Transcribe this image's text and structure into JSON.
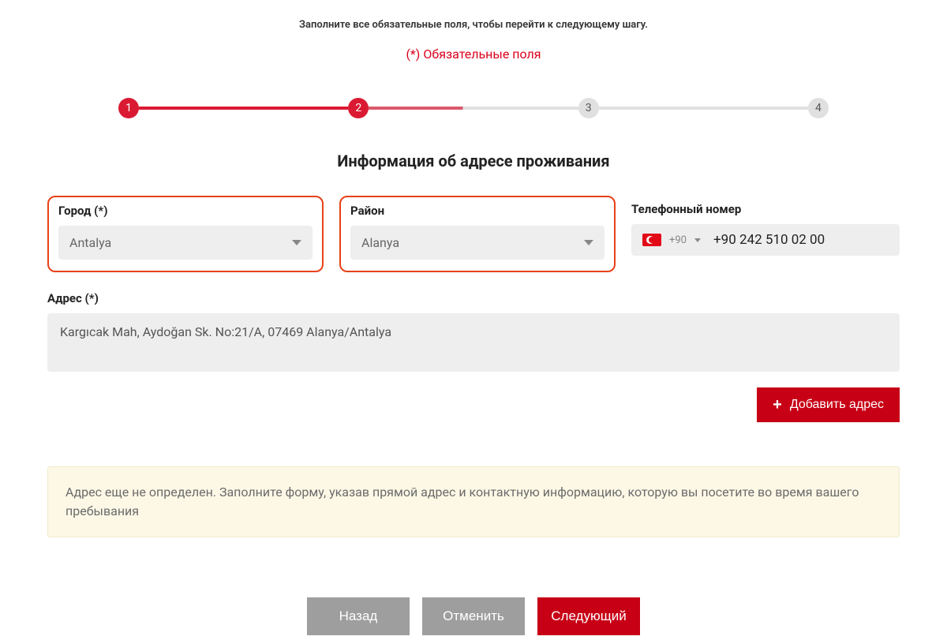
{
  "instruction": "Заполните все обязательные поля, чтобы перейти к следующему шагу.",
  "required_note": "(*) Обязательные поля",
  "stepper": {
    "s1": "1",
    "s2": "2",
    "s3": "3",
    "s4": "4"
  },
  "section_title": "Информация об адресе проживания",
  "city": {
    "label": "Город (*)",
    "value": "Antalya"
  },
  "district": {
    "label": "Район",
    "value": "Alanya"
  },
  "phone": {
    "label": "Телефонный номер",
    "cc": "+90",
    "value": "+90 242 510 02 00"
  },
  "address": {
    "label": "Адрес (*)",
    "value": "Kargıcak Mah, Aydoğan Sk. No:21/A, 07469 Alanya/Antalya"
  },
  "add_btn": "Добавить адрес",
  "alert": "Адрес еще не определен. Заполните форму, указав прямой адрес и контактную информацию, которую вы посетите во время вашего пребывания",
  "footer": {
    "back": "Назад",
    "cancel": "Отменить",
    "next": "Следующий"
  }
}
